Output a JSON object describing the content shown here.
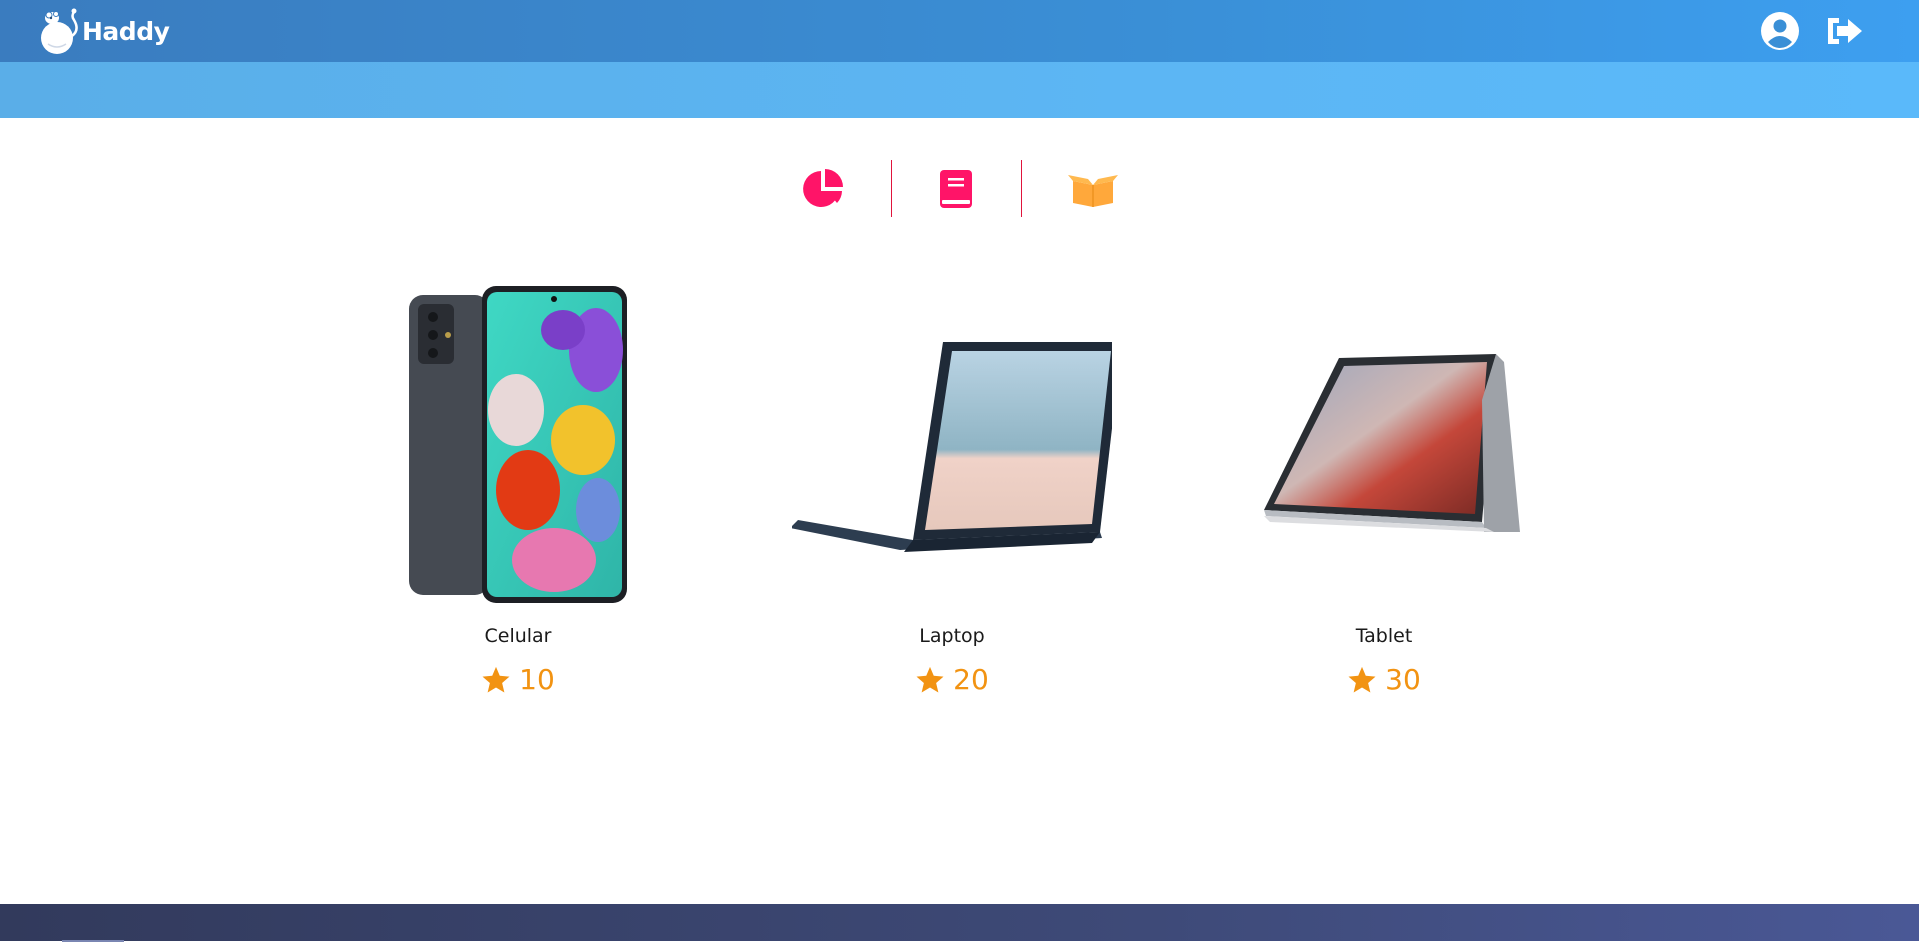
{
  "header": {
    "logo_text": "Haddy",
    "profile_icon": "user-circle-icon",
    "logout_icon": "sign-out-icon"
  },
  "tabs": [
    {
      "icon": "pie-chart-icon",
      "color": "#ff1468"
    },
    {
      "icon": "book-icon",
      "color": "#ff1468"
    },
    {
      "icon": "open-box-icon",
      "color": "#ffa83b"
    }
  ],
  "products": [
    {
      "name": "Celular",
      "points": "10",
      "image": "smartphone"
    },
    {
      "name": "Laptop",
      "points": "20",
      "image": "laptop"
    },
    {
      "name": "Tablet",
      "points": "30",
      "image": "tablet"
    }
  ],
  "colors": {
    "topbar": "#3a8fd6",
    "subbar": "#5cb6f4",
    "accent_pink": "#ff1468",
    "star_orange": "#f29312",
    "footer": "#3e4a78"
  }
}
